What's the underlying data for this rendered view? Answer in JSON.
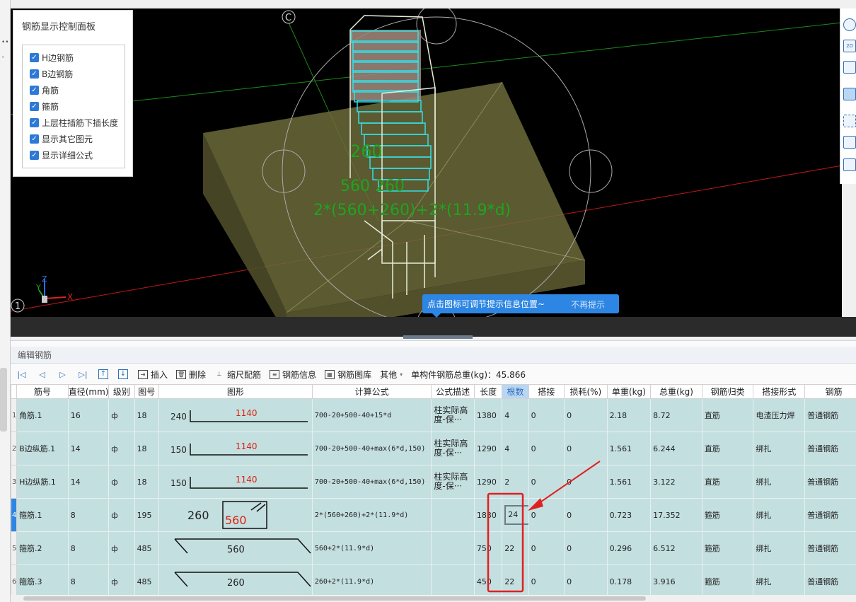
{
  "control_panel": {
    "title": "钢筋显示控制面板",
    "options": [
      {
        "label": "H边钢筋",
        "checked": true
      },
      {
        "label": "B边钢筋",
        "checked": true
      },
      {
        "label": "角筋",
        "checked": true
      },
      {
        "label": "箍筋",
        "checked": true
      },
      {
        "label": "上层柱插筋下插长度",
        "checked": true
      },
      {
        "label": "显示其它图元",
        "checked": true
      },
      {
        "label": "显示详细公式",
        "checked": true
      }
    ]
  },
  "viewport": {
    "axis_label_c": "C",
    "axis_label_1": "1",
    "axis_x": "X",
    "axis_y": "Y",
    "axis_z": "Z",
    "dim_260": "260",
    "dim_560_260": "560   260",
    "dim_formula": "2*(560+260)+2*(11.9*d)"
  },
  "tooltip": {
    "text": "点击图标可调节提示信息位置~",
    "dismiss": "不再提示"
  },
  "panel": {
    "title": "编辑钢筋",
    "toolbar": {
      "insert": "插入",
      "delete": "删除",
      "scale": "缩尺配筋",
      "info": "钢筋信息",
      "library": "钢筋图库",
      "other": "其他",
      "total_weight": "单构件钢筋总重(kg)：45.866"
    },
    "columns": [
      "筋号",
      "直径(mm)",
      "级别",
      "图号",
      "图形",
      "计算公式",
      "公式描述",
      "长度",
      "根数",
      "搭接",
      "损耗(%)",
      "单重(kg)",
      "总重(kg)",
      "钢筋归类",
      "搭接形式",
      "钢筋"
    ],
    "rows": [
      {
        "no": "1",
        "name": "角筋.1",
        "dia": "16",
        "grade": "ф",
        "fig": "18",
        "shape_left": "240",
        "shape_mid": "1140",
        "formula": "700-20+500-40+15*d",
        "desc": "柱实际高度-保···",
        "length": "1380",
        "count": "4",
        "lap": "0",
        "loss": "0",
        "unit_w": "2.18",
        "total_w": "8.72",
        "cat": "直筋",
        "lap_type": "电渣压力焊",
        "kind": "普通钢筋"
      },
      {
        "no": "2",
        "name": "B边纵筋.1",
        "dia": "14",
        "grade": "ф",
        "fig": "18",
        "shape_left": "150",
        "shape_mid": "1140",
        "formula": "700-20+500-40+max(6*d,150)",
        "desc": "柱实际高度-保···",
        "length": "1290",
        "count": "4",
        "lap": "0",
        "loss": "0",
        "unit_w": "1.561",
        "total_w": "6.244",
        "cat": "直筋",
        "lap_type": "绑扎",
        "kind": "普通钢筋"
      },
      {
        "no": "3",
        "name": "H边纵筋.1",
        "dia": "14",
        "grade": "ф",
        "fig": "18",
        "shape_left": "150",
        "shape_mid": "1140",
        "formula": "700-20+500-40+max(6*d,150)",
        "desc": "柱实际高度-保···",
        "length": "1290",
        "count": "2",
        "lap": "0",
        "loss": "0",
        "unit_w": "1.561",
        "total_w": "3.122",
        "cat": "直筋",
        "lap_type": "绑扎",
        "kind": "普通钢筋"
      },
      {
        "no": "4",
        "name": "箍筋.1",
        "dia": "8",
        "grade": "ф",
        "fig": "195",
        "shape_left": "260",
        "shape_mid": "560",
        "formula": "2*(560+260)+2*(11.9*d)",
        "desc": "",
        "length": "1830",
        "count": "24",
        "lap": "0",
        "loss": "0",
        "unit_w": "0.723",
        "total_w": "17.352",
        "cat": "箍筋",
        "lap_type": "绑扎",
        "kind": "普通钢筋"
      },
      {
        "no": "5",
        "name": "箍筋.2",
        "dia": "8",
        "grade": "ф",
        "fig": "485",
        "shape_left": "",
        "shape_mid": "560",
        "formula": "560+2*(11.9*d)",
        "desc": "",
        "length": "750",
        "count": "22",
        "lap": "0",
        "loss": "0",
        "unit_w": "0.296",
        "total_w": "6.512",
        "cat": "箍筋",
        "lap_type": "绑扎",
        "kind": "普通钢筋"
      },
      {
        "no": "6",
        "name": "箍筋.3",
        "dia": "8",
        "grade": "ф",
        "fig": "485",
        "shape_left": "",
        "shape_mid": "260",
        "formula": "260+2*(11.9*d)",
        "desc": "",
        "length": "450",
        "count": "22",
        "lap": "0",
        "loss": "0",
        "unit_w": "0.178",
        "total_w": "3.916",
        "cat": "箍筋",
        "lap_type": "绑扎",
        "kind": "普通钢筋"
      }
    ]
  },
  "colors": {
    "accent": "#2d86e3",
    "row_bg": "#c4dfe0",
    "annotation_red": "#e02020",
    "rebar_cyan": "#33e0e8",
    "foundation": "#6b6a3a"
  }
}
